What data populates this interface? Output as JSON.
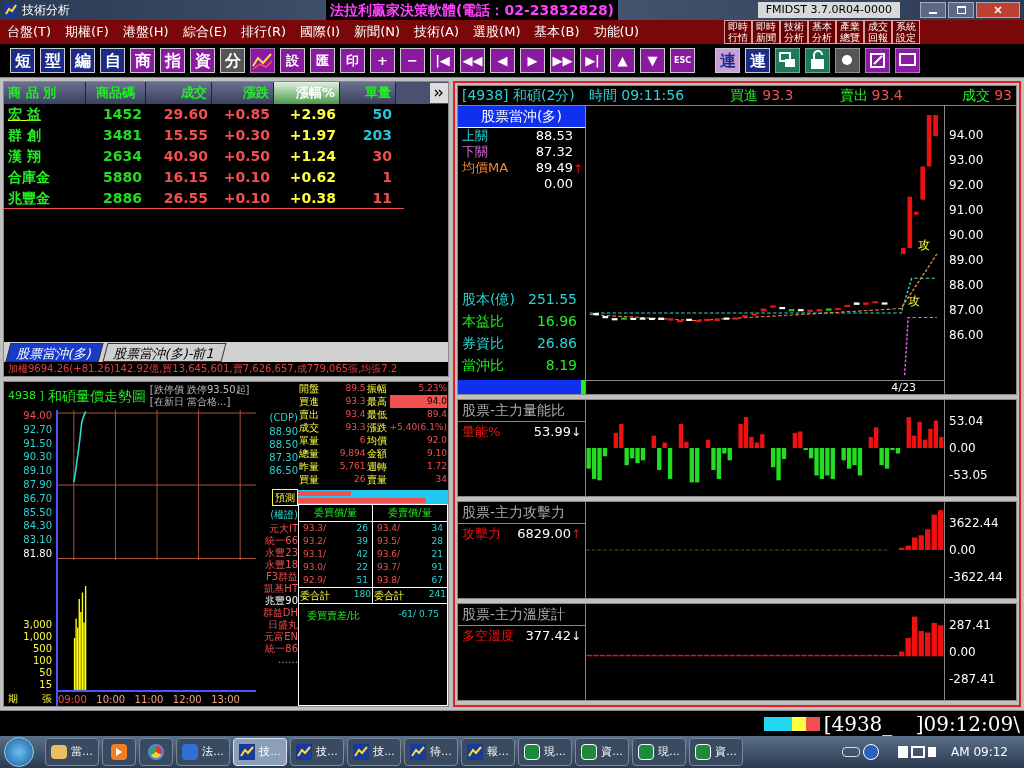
{
  "title_bar": {
    "app_title": "技術分析",
    "banner": "法拉利贏家決策軟體(電話：02-23832828)",
    "version": "FMIDST 3.7.0R04-0000"
  },
  "menu": [
    "台盤(T)",
    "期權(F)",
    "港盤(H)",
    "綜合(E)",
    "排行(R)",
    "國際(I)",
    "新聞(N)",
    "技術(A)",
    "選股(M)",
    "基本(B)",
    "功能(U)"
  ],
  "quick_buttons": [
    {
      "line1": "即時",
      "line2": "行情"
    },
    {
      "line1": "即時",
      "line2": "新聞"
    },
    {
      "line1": "技術",
      "line2": "分析"
    },
    {
      "line1": "基本",
      "line2": "分析"
    },
    {
      "line1": "產業",
      "line2": "總覽"
    },
    {
      "line1": "成交",
      "line2": "回報"
    },
    {
      "line1": "系統",
      "line2": "設定"
    }
  ],
  "toolbar": {
    "keys_a": [
      "短",
      "型",
      "編",
      "自",
      "商",
      "指",
      "資",
      "分"
    ],
    "keys_b": [
      "設",
      "匯",
      "印",
      "+",
      "−",
      "|◀",
      "◀◀",
      "◀",
      "▶",
      "▶▶",
      "▶|",
      "▲",
      "▼",
      "ESC"
    ],
    "keys_c": [
      {
        "label": "連",
        "selected": true
      },
      {
        "label": "連",
        "selected": false
      }
    ]
  },
  "quote_table": {
    "columns": [
      {
        "label": "商 品 別",
        "selected": false
      },
      {
        "label": "商品碼",
        "selected": false
      },
      {
        "label": "成交",
        "selected": false
      },
      {
        "label": "漲跌",
        "selected": false
      },
      {
        "label": "漲幅%",
        "selected": true
      },
      {
        "label": "單量",
        "selected": false
      }
    ],
    "rows": [
      {
        "name": "宏 益",
        "code": "1452",
        "price": "29.60",
        "change": "+0.85",
        "pct": "+2.96",
        "volume": "50",
        "color": "#22c5d8",
        "selected": true
      },
      {
        "name": "群 創",
        "code": "3481",
        "price": "15.55",
        "change": "+0.30",
        "pct": "+1.97",
        "volume": "203",
        "color": "#22c5d8",
        "selected": false
      },
      {
        "name": "漢 翔",
        "code": "2634",
        "price": "40.90",
        "change": "+0.50",
        "pct": "+1.24",
        "volume": "30",
        "color": "#f05050",
        "selected": false
      },
      {
        "name": "合庫金",
        "code": "5880",
        "price": "16.15",
        "change": "+0.10",
        "pct": "+0.62",
        "volume": "1",
        "color": "#f05050",
        "selected": false
      },
      {
        "name": "兆豐金",
        "code": "2886",
        "price": "26.55",
        "change": "+0.10",
        "pct": "+0.38",
        "volume": "11",
        "color": "#f05050",
        "selected": false
      }
    ]
  },
  "list_tabs": [
    {
      "label": "股票當沖(多)",
      "selected": true
    },
    {
      "label": "股票當沖(多)-前1",
      "selected": false
    }
  ],
  "index_ticker": "加權9694.26(+81.26)142.92億,買13,645,601,賣7,626,657,成779,065張,均張7.2",
  "trend": {
    "code_label": "4938 ]",
    "title": "和碩量價走勢圖",
    "notes": [
      "[跌停價 跌停93.50起]",
      "[在新日 當合格...]"
    ],
    "price_axis": [
      "94.00",
      "92.70",
      "91.50",
      "90.30",
      "89.10",
      "87.90",
      "86.70",
      "85.50",
      "84.30",
      "83.10",
      "81.80"
    ],
    "volume_axis": [
      "3,000",
      "1,000",
      "500",
      "100",
      "50",
      "15"
    ],
    "axis_units": [
      "期",
      "張"
    ],
    "times": [
      "09:00",
      "10:00",
      "11:00",
      "12:00",
      "13:00"
    ],
    "cdp_label": "(CDP)",
    "cdp": [
      "88.90",
      "88.50",
      "87.30",
      "86.50"
    ],
    "forecast": "預測",
    "warrant_label": "(權證)",
    "warrants": [
      "元大IT",
      "統一66",
      "永豐23",
      "永豐18",
      "F3群益",
      "凱基HT",
      "兆豐90",
      "群益DH",
      "日盛丸",
      "元富EN",
      "統一86"
    ],
    "more": "……",
    "quote": [
      {
        "l1": "開盤",
        "v1": "89.5",
        "l2": "振幅",
        "v2": "5.23%",
        "highlight": false
      },
      {
        "l1": "買進",
        "v1": "93.3",
        "l2": "最高",
        "v2": "94.0",
        "highlight": true
      },
      {
        "l1": "賣出",
        "v1": "93.4",
        "l2": "最低",
        "v2": "89.4",
        "highlight": false
      },
      {
        "l1": "成交",
        "v1": "93.3",
        "l2": "漲跌",
        "v2": "+5.40(6.1%)",
        "highlight": false
      },
      {
        "l1": "單量",
        "v1": "6",
        "l2": "均價",
        "v2": "92.0",
        "highlight": false
      },
      {
        "l1": "總量",
        "v1": "9,894",
        "l2": "金額",
        "v2": "9.10",
        "highlight": false
      },
      {
        "l1": "昨量",
        "v1": "5,761",
        "l2": "週轉",
        "v2": "1.72",
        "highlight": false
      },
      {
        "l1": "買量",
        "v1": "26",
        "l2": "賣量",
        "v2": "34",
        "highlight": false
      }
    ],
    "book_headers": [
      "委買價/量",
      "委賣價/量"
    ],
    "book": [
      {
        "bp": "93.3/",
        "bq": "26",
        "ap": "93.4/",
        "aq": "34"
      },
      {
        "bp": "93.2/",
        "bq": "39",
        "ap": "93.5/",
        "aq": "28"
      },
      {
        "bp": "93.1/",
        "bq": "42",
        "ap": "93.6/",
        "aq": "21"
      },
      {
        "bp": "93.0/",
        "bq": "22",
        "ap": "93.7/",
        "aq": "91"
      },
      {
        "bp": "92.9/",
        "bq": "51",
        "ap": "93.8/",
        "aq": "67"
      }
    ],
    "totals": [
      {
        "label": "委合計",
        "value": "180"
      },
      {
        "label": "委合計",
        "value": "241"
      }
    ],
    "diff_label": "委買賣差/比",
    "diff_value": "-61/ 0.75"
  },
  "kchart": {
    "title": "[4938] 和碩(2分)",
    "fields": [
      {
        "label": "時間",
        "value": "09:11:56"
      },
      {
        "label": "買進",
        "value": "93.3"
      },
      {
        "label": "賣出",
        "value": "93.4"
      },
      {
        "label": "成交",
        "value": "93"
      }
    ],
    "strategy": "股票當沖(多)",
    "levels": [
      {
        "label": "上關",
        "value": "88.53"
      },
      {
        "label": "下關",
        "value": "87.32"
      },
      {
        "label": "均價MA",
        "value": "89.49",
        "arrow": "↑"
      },
      {
        "value": "0.00"
      }
    ],
    "stats": [
      {
        "label": "股本(億)",
        "value": "251.55"
      },
      {
        "label": "本益比",
        "value": "16.96"
      },
      {
        "label": "券資比",
        "value": "26.86"
      },
      {
        "label": "當沖比",
        "value": "8.19"
      }
    ],
    "y_axis": [
      "94.00",
      "93.00",
      "92.00",
      "91.00",
      "90.00",
      "89.00",
      "88.00",
      "87.00",
      "86.00"
    ],
    "date": "4/23",
    "signals": [
      "攻",
      "攻"
    ]
  },
  "indicators": [
    {
      "title": "股票-主力量能比",
      "label": "量能%",
      "value": "53.99",
      "arrow": "↓",
      "scale": [
        "53.04",
        "0.00",
        "-53.05"
      ],
      "kind": "volume"
    },
    {
      "title": "股票-主力攻擊力",
      "label": "攻擊力",
      "value": "6829.00",
      "arrow": "↑",
      "scale": [
        "3622.44",
        "0.00",
        "-3622.44"
      ],
      "kind": "attack"
    },
    {
      "title": "股票-主力溫度計",
      "label": "多空溫度",
      "value": "377.42",
      "arrow": "↓",
      "scale": [
        "287.41",
        "0.00",
        "-287.41"
      ],
      "kind": "heat"
    }
  ],
  "status": {
    "code_field": "[4938_",
    "clock": "]09:12:09\\"
  },
  "taskbar": {
    "items": [
      {
        "kind": "folder",
        "label": "當...",
        "selected": false
      },
      {
        "kind": "media",
        "selected": false
      },
      {
        "kind": "browser",
        "selected": false
      },
      {
        "kind": "app",
        "label": "法...",
        "selected": false
      },
      {
        "kind": "chart",
        "label": "技...",
        "selected": true
      },
      {
        "kind": "chart",
        "label": "技...",
        "selected": false
      },
      {
        "kind": "chart",
        "label": "技...",
        "selected": false
      },
      {
        "kind": "chart",
        "label": "待...",
        "selected": false
      },
      {
        "kind": "chart",
        "label": "報...",
        "selected": false
      },
      {
        "kind": "sheet",
        "label": "現...",
        "selected": false
      },
      {
        "kind": "sheet",
        "label": "資...",
        "selected": false
      },
      {
        "kind": "sheet",
        "label": "現...",
        "selected": false
      },
      {
        "kind": "sheet",
        "label": "資...",
        "selected": false
      }
    ],
    "clock": "AM 09:12"
  }
}
